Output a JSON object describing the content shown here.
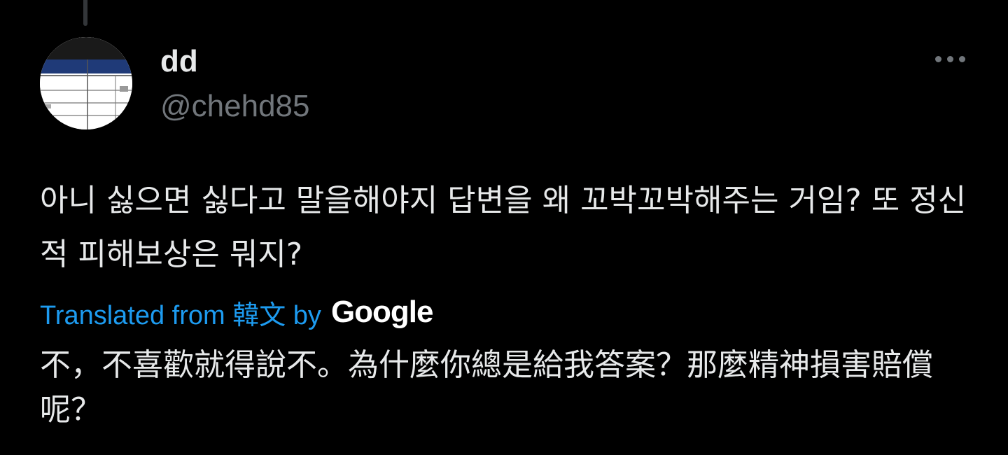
{
  "author": {
    "display_name": "dd",
    "handle": "@chehd85",
    "avatar_icon": "table-document-avatar"
  },
  "menu": {
    "icon": "more-horizontal-icon"
  },
  "tweet": {
    "text": "아니 싫으면 싫다고 말을해야지 답변을 왜 꼬박꼬박해주는 거임? 또 정신적 피해보상은 뭐지?"
  },
  "translation": {
    "label": "Translated from 韓文 by",
    "provider": "Google",
    "text": "不，不喜歡就得說不。為什麼你總是給我答案？那麼精神損害賠償呢？"
  },
  "colors": {
    "background": "#000000",
    "primary_text": "#e7e9ea",
    "secondary_text": "#71767b",
    "link": "#1d9bf0"
  }
}
